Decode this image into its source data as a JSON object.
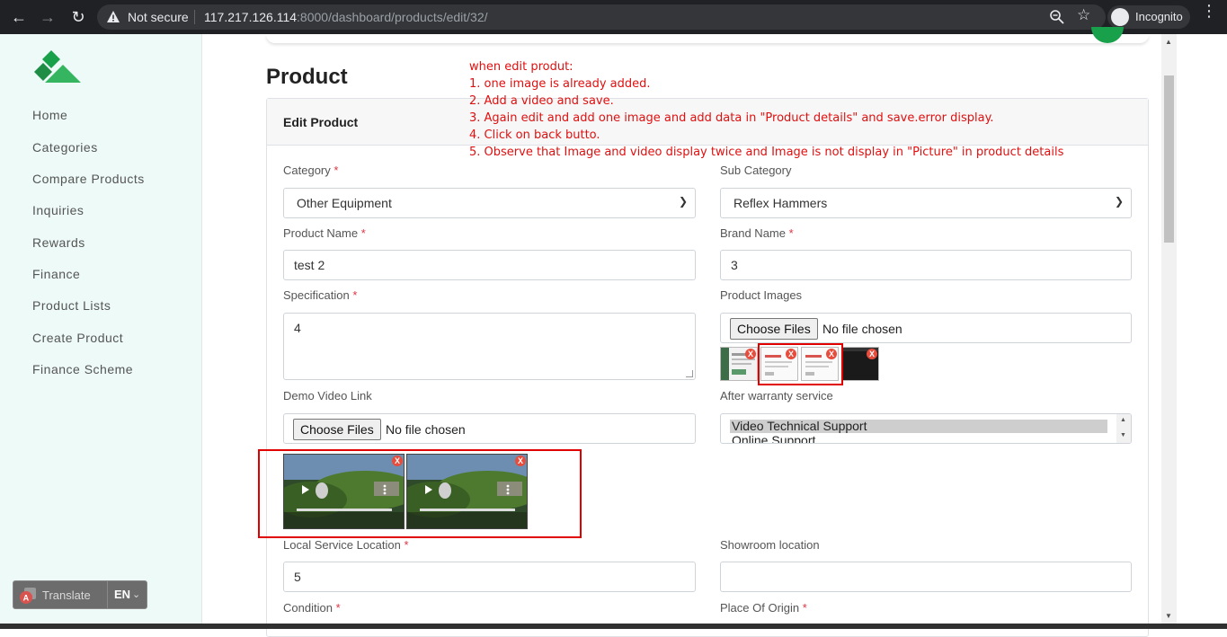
{
  "browser": {
    "security_label": "Not secure",
    "url_host": "117.217.126.114",
    "url_path": ":8000/dashboard/products/edit/32/",
    "profile_label": "Incognito"
  },
  "sidebar": {
    "items": [
      {
        "label": "Home"
      },
      {
        "label": "Categories"
      },
      {
        "label": "Compare Products"
      },
      {
        "label": "Inquiries"
      },
      {
        "label": "Rewards"
      },
      {
        "label": "Finance"
      },
      {
        "label": "Product Lists"
      },
      {
        "label": "Create Product"
      },
      {
        "label": "Finance Scheme"
      }
    ],
    "translate_label": "Translate",
    "language": "EN"
  },
  "page": {
    "title": "Product",
    "card_title": "Edit Product"
  },
  "form": {
    "category_label": "Category",
    "category_value": "Other Equipment",
    "sub_category_label": "Sub Category",
    "sub_category_value": "Reflex Hammers",
    "product_name_label": "Product Name",
    "product_name_value": "test 2",
    "brand_name_label": "Brand Name",
    "brand_name_value": "3",
    "specification_label": "Specification",
    "specification_value": "4",
    "product_images_label": "Product Images",
    "choose_files": "Choose Files",
    "no_file": "No file chosen",
    "demo_video_label": "Demo Video Link",
    "warranty_label": "After warranty service",
    "warranty_options": [
      "Video Technical Support",
      "Online Support"
    ],
    "local_service_label": "Local Service Location",
    "local_service_value": "5",
    "showroom_label": "Showroom location",
    "showroom_value": "",
    "condition_label": "Condition",
    "origin_label": "Place Of Origin",
    "required_mark": "*",
    "remove_mark": "X"
  },
  "annotation": {
    "lines": [
      "when edit produt:",
      "1. one image is already added.",
      "2. Add a video and save.",
      "3. Again edit  and add one image and add data in \"Product details\" and save.error display.",
      "4. Click on back butto.",
      "5. Observe that Image and video display twice and Image is not display in \"Picture\" in product details"
    ],
    "color": "#e01010"
  },
  "colors": {
    "brand_green": "#18a04a",
    "sidebar_bg": "#edfaf8",
    "annotation_box": "#e00000"
  }
}
